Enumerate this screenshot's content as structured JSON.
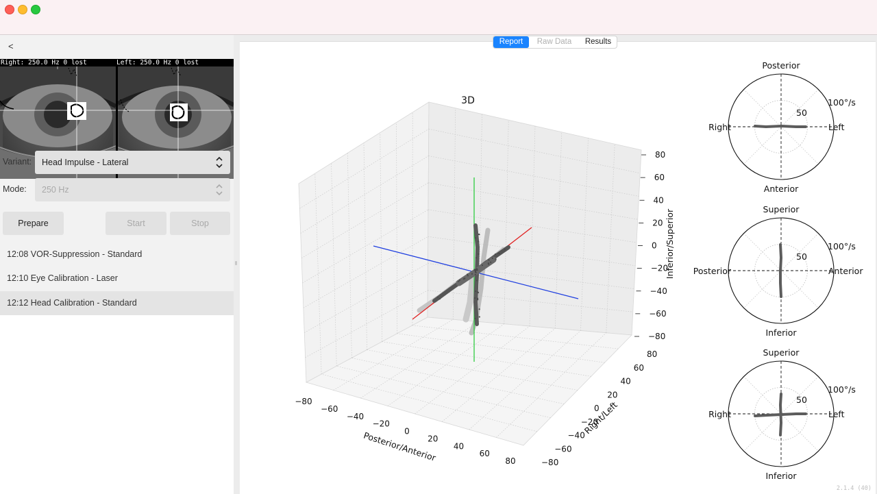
{
  "app": {
    "back_label": "<",
    "version": "2.1.4 (40)"
  },
  "cameras": {
    "right_label": "Right: 250.0 Hz 0 lost",
    "left_label": "Left: 250.0 Hz 0 lost"
  },
  "form": {
    "variant_label": "Variant:",
    "variant_value": "Head Impulse - Lateral",
    "mode_label": "Mode:",
    "mode_value": "250 Hz"
  },
  "buttons": {
    "prepare": "Prepare",
    "start": "Start",
    "stop": "Stop"
  },
  "history": [
    {
      "label": "12:08 VOR-Suppression - Standard",
      "selected": false
    },
    {
      "label": "12:10 Eye Calibration - Laser",
      "selected": false
    },
    {
      "label": "12:12 Head Calibration - Standard",
      "selected": true
    }
  ],
  "tabs": [
    {
      "label": "Report",
      "state": "active"
    },
    {
      "label": "Raw Data",
      "state": "disabled"
    },
    {
      "label": "Results",
      "state": "normal"
    }
  ],
  "chart3d": {
    "title": "3D",
    "xlabel": "Posterior/Anterior",
    "ylabel": "Right/Left",
    "zlabel": "Inferior/Superior",
    "x_ticks": [
      "−80",
      "−60",
      "−40",
      "−20",
      "0",
      "20",
      "40",
      "60",
      "80"
    ],
    "y_ticks": [
      "−80",
      "−60",
      "−40",
      "−20",
      "0",
      "20",
      "40",
      "60",
      "80"
    ],
    "z_ticks": [
      "80",
      "60",
      "40",
      "20",
      "0",
      "−20",
      "−40",
      "−60",
      "−80"
    ]
  },
  "polars": [
    {
      "top": "Posterior",
      "bottom": "Anterior",
      "left": "Right",
      "right": "Left",
      "ring_inner": "50",
      "ring_outer": "100°/s"
    },
    {
      "top": "Superior",
      "bottom": "Inferior",
      "left": "Posterior",
      "right": "Anterior",
      "ring_inner": "50",
      "ring_outer": "100°/s"
    },
    {
      "top": "Superior",
      "bottom": "Inferior",
      "left": "Right",
      "right": "Left",
      "ring_inner": "50",
      "ring_outer": "100°/s"
    }
  ],
  "colors": {
    "accent": "#1a84ff",
    "axis_red": "#e02020",
    "axis_green": "#2ecc40",
    "axis_blue": "#1f3fe0",
    "trace_dark": "#555555",
    "trace_light": "#b5b5b5"
  }
}
